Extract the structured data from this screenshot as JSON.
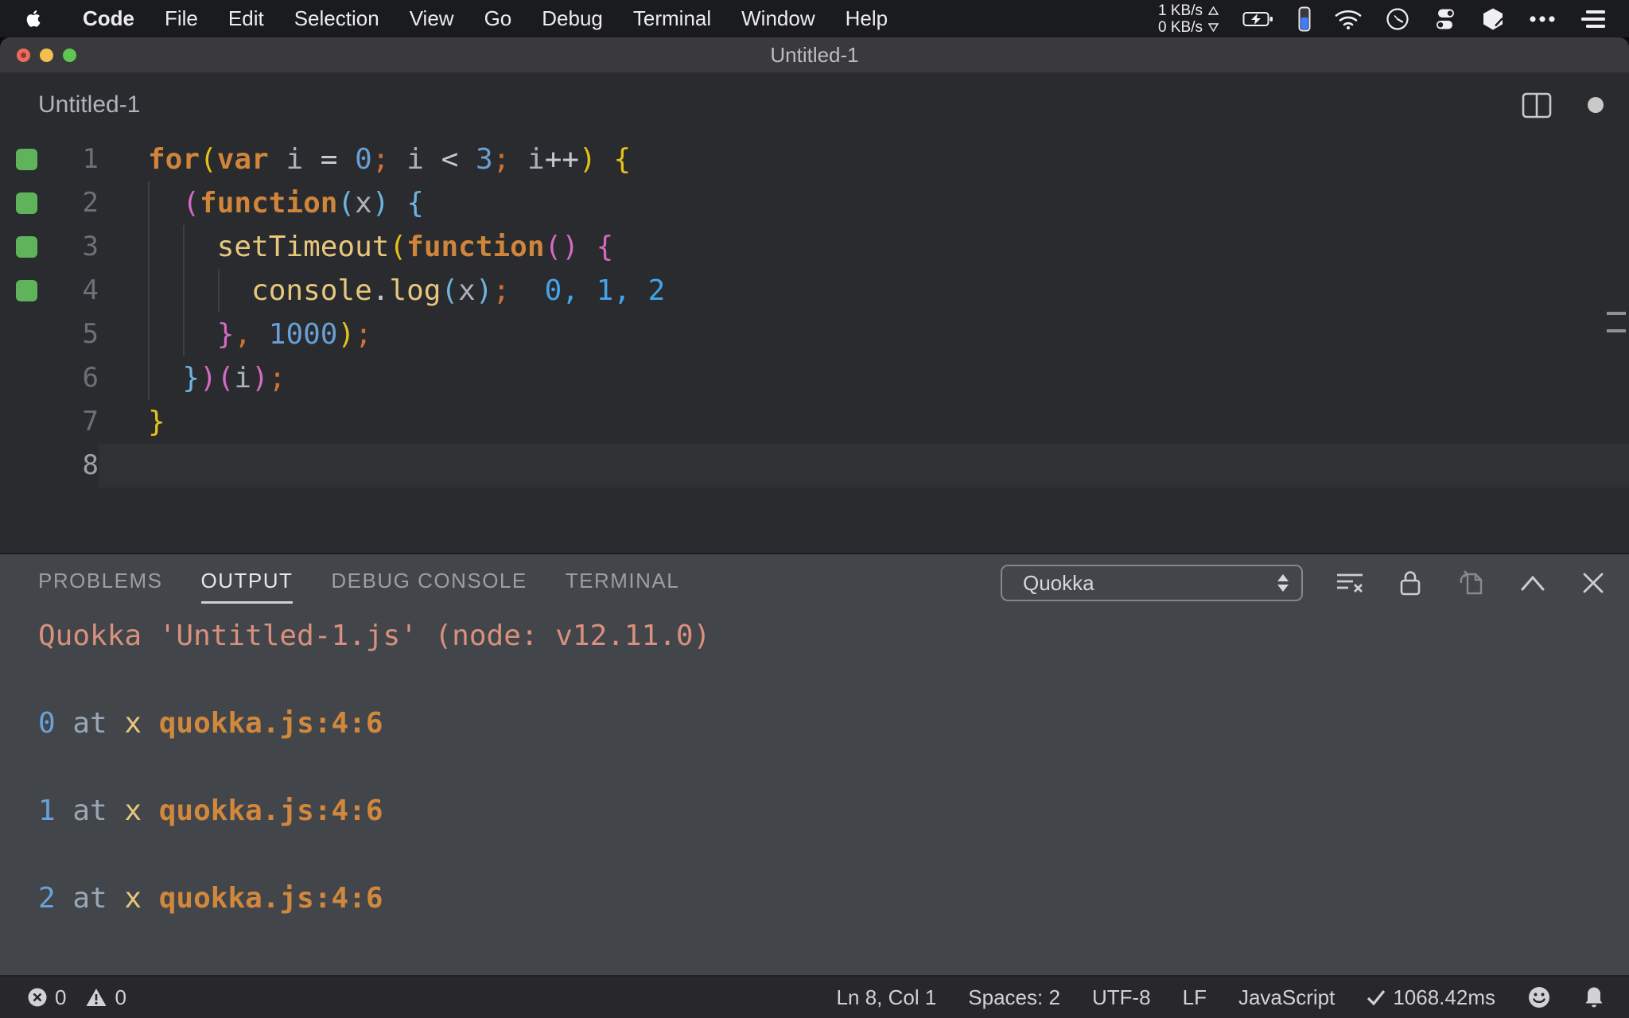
{
  "menubar": {
    "items": [
      {
        "label": "Code",
        "bold": true
      },
      {
        "label": "File"
      },
      {
        "label": "Edit"
      },
      {
        "label": "Selection"
      },
      {
        "label": "View"
      },
      {
        "label": "Go"
      },
      {
        "label": "Debug"
      },
      {
        "label": "Terminal"
      },
      {
        "label": "Window"
      },
      {
        "label": "Help"
      }
    ],
    "net_up": "1 KB/s",
    "net_down": "0 KB/s"
  },
  "window": {
    "title": "Untitled-1"
  },
  "editor": {
    "tab_title": "Untitled-1",
    "lines": [
      {
        "num": 1,
        "run": true,
        "guides": 0,
        "current": false,
        "tokens": [
          {
            "c": "kw",
            "t": "for"
          },
          {
            "c": "by",
            "t": "("
          },
          {
            "c": "kw",
            "t": "var"
          },
          {
            "c": "ws",
            "t": " "
          },
          {
            "c": "id",
            "t": "i"
          },
          {
            "c": "op",
            "t": " = "
          },
          {
            "c": "num",
            "t": "0"
          },
          {
            "c": "pun",
            "t": ";"
          },
          {
            "c": "ws",
            "t": " "
          },
          {
            "c": "id",
            "t": "i"
          },
          {
            "c": "op",
            "t": " < "
          },
          {
            "c": "num",
            "t": "3"
          },
          {
            "c": "pun",
            "t": ";"
          },
          {
            "c": "ws",
            "t": " "
          },
          {
            "c": "id",
            "t": "i"
          },
          {
            "c": "op",
            "t": "++"
          },
          {
            "c": "by",
            "t": ")"
          },
          {
            "c": "ws",
            "t": " "
          },
          {
            "c": "by",
            "t": "{"
          }
        ]
      },
      {
        "num": 2,
        "run": true,
        "guides": 1,
        "current": false,
        "tokens": [
          {
            "c": "ws",
            "t": "  "
          },
          {
            "c": "bp",
            "t": "("
          },
          {
            "c": "kw",
            "t": "function"
          },
          {
            "c": "bb",
            "t": "("
          },
          {
            "c": "id",
            "t": "x"
          },
          {
            "c": "bb",
            "t": ")"
          },
          {
            "c": "ws",
            "t": " "
          },
          {
            "c": "bb",
            "t": "{"
          }
        ]
      },
      {
        "num": 3,
        "run": true,
        "guides": 2,
        "current": false,
        "tokens": [
          {
            "c": "ws",
            "t": "    "
          },
          {
            "c": "fn",
            "t": "setTimeout"
          },
          {
            "c": "by",
            "t": "("
          },
          {
            "c": "kw",
            "t": "function"
          },
          {
            "c": "bp",
            "t": "()"
          },
          {
            "c": "ws",
            "t": " "
          },
          {
            "c": "bp",
            "t": "{"
          }
        ]
      },
      {
        "num": 4,
        "run": true,
        "guides": 3,
        "current": false,
        "tokens": [
          {
            "c": "ws",
            "t": "      "
          },
          {
            "c": "fn",
            "t": "console"
          },
          {
            "c": "op",
            "t": "."
          },
          {
            "c": "fn",
            "t": "log"
          },
          {
            "c": "bb",
            "t": "("
          },
          {
            "c": "id",
            "t": "x"
          },
          {
            "c": "bb",
            "t": ")"
          },
          {
            "c": "pun",
            "t": ";"
          },
          {
            "c": "qv",
            "t": "  0, 1, 2"
          }
        ]
      },
      {
        "num": 5,
        "run": false,
        "guides": 2,
        "current": false,
        "tokens": [
          {
            "c": "ws",
            "t": "    "
          },
          {
            "c": "bp",
            "t": "}"
          },
          {
            "c": "pun",
            "t": ","
          },
          {
            "c": "ws",
            "t": " "
          },
          {
            "c": "num",
            "t": "1000"
          },
          {
            "c": "by",
            "t": ")"
          },
          {
            "c": "pun",
            "t": ";"
          }
        ]
      },
      {
        "num": 6,
        "run": false,
        "guides": 1,
        "current": false,
        "tokens": [
          {
            "c": "ws",
            "t": "  "
          },
          {
            "c": "bb",
            "t": "}"
          },
          {
            "c": "bp",
            "t": ")("
          },
          {
            "c": "id",
            "t": "i"
          },
          {
            "c": "bp",
            "t": ")"
          },
          {
            "c": "pun",
            "t": ";"
          }
        ]
      },
      {
        "num": 7,
        "run": false,
        "guides": 0,
        "current": false,
        "tokens": [
          {
            "c": "by",
            "t": "}"
          }
        ]
      },
      {
        "num": 8,
        "run": false,
        "guides": 0,
        "current": true,
        "tokens": []
      }
    ]
  },
  "panel": {
    "tabs": [
      {
        "label": "PROBLEMS",
        "active": false
      },
      {
        "label": "OUTPUT",
        "active": true
      },
      {
        "label": "DEBUG CONSOLE",
        "active": false
      },
      {
        "label": "TERMINAL",
        "active": false
      }
    ],
    "dropdown_value": "Quokka",
    "output": {
      "header": "Quokka 'Untitled-1.js' (node: v12.11.0)",
      "entries": [
        {
          "value": "0",
          "keyword": "at",
          "variable": "x",
          "location": "quokka.js:4:6"
        },
        {
          "value": "1",
          "keyword": "at",
          "variable": "x",
          "location": "quokka.js:4:6"
        },
        {
          "value": "2",
          "keyword": "at",
          "variable": "x",
          "location": "quokka.js:4:6"
        }
      ]
    }
  },
  "statusbar": {
    "errors": "0",
    "warnings": "0",
    "cursor": "Ln 8, Col 1",
    "indent": "Spaces: 2",
    "encoding": "UTF-8",
    "eol": "LF",
    "language": "JavaScript",
    "perf": "1068.42ms"
  },
  "colors": {
    "kw": "#d0853b",
    "fn": "#e8c77d",
    "num": "#689fd4",
    "id": "#a9b2bc",
    "op": "#c3cad2",
    "pun": "#cf7035",
    "by": "#e6c118",
    "bp": "#d36ac2",
    "bb": "#6fb3e0",
    "qv": "#45a3e8",
    "out_header": "#d9907c",
    "out_num": "#6ba1d8",
    "out_at": "#9aa7b4",
    "out_var": "#e8c77d",
    "out_loc": "#d2883c",
    "gutter_green": "#5fb45b",
    "traffic_red": "#ed6a5e",
    "traffic_yellow": "#f4bf4f",
    "traffic_green": "#61c555",
    "phone_battery_blue": "#3d7eff"
  }
}
